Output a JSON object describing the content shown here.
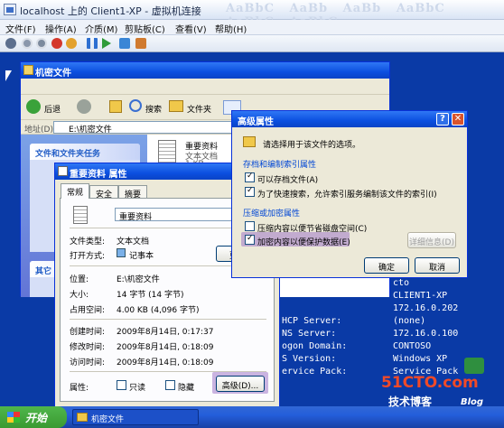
{
  "host": {
    "title": "localhost 上的 Client1-XP - 虚拟机连接",
    "menu": [
      "文件(F)",
      "操作(A)",
      "介质(M)",
      "剪贴板(C)",
      "查看(V)",
      "帮助(H)"
    ]
  },
  "explorer": {
    "title": "机密文件",
    "back": "后退",
    "search": "搜索",
    "folders": "文件夹",
    "address_label": "地址(D)",
    "address_value": "E:\\机密文件",
    "task_panel_title": "文件和文件夹任务",
    "other_panel_title": "其它",
    "file_name": "重要资料",
    "file_type": "文本文档",
    "file_size": "1 KB"
  },
  "console": {
    "lines": [
      "cto",
      "CLIENT1-XP",
      "172.16.0.202",
      "(none)",
      "172.16.0.100",
      "CONTOSO",
      "Windows XP",
      "Service Pack"
    ],
    "labels": [
      "HCP Server:",
      "NS Server:",
      "ogon Domain:",
      "S Version:",
      "ervice Pack:"
    ]
  },
  "props": {
    "title": "重要资料 属性",
    "tabs": [
      "常规",
      "安全",
      "摘要"
    ],
    "name_value": "重要资料",
    "type_label": "文件类型:",
    "type_value": "文本文档",
    "open_label": "打开方式:",
    "open_value": "记事本",
    "change_btn": "更改",
    "loc_label": "位置:",
    "loc_value": "E:\\机密文件",
    "size_label": "大小:",
    "size_value": "14 字节 (14 字节)",
    "disk_label": "占用空间:",
    "disk_value": "4.00 KB (4,096 字节)",
    "created_label": "创建时间:",
    "created_value": "2009年8月14日, 0:17:37",
    "modified_label": "修改时间:",
    "modified_value": "2009年8月14日, 0:18:09",
    "accessed_label": "访问时间:",
    "accessed_value": "2009年8月14日, 0:18:09",
    "attr_label": "属性:",
    "readonly": "只读",
    "hidden": "隐藏",
    "advanced_btn": "高级(D)..."
  },
  "advanced": {
    "title": "高级属性",
    "desc": "请选择用于该文件的选项。",
    "group1": "存档和编制索引属性",
    "opt_archive": "可以存档文件(A)",
    "opt_index": "为了快速搜索，允许索引服务编制该文件的索引(I)",
    "group2": "压缩或加密属性",
    "opt_compress": "压缩内容以便节省磁盘空间(C)",
    "opt_encrypt": "加密内容以便保护数据(E)",
    "details_btn": "详细信息(D)",
    "ok": "确定",
    "cancel": "取消"
  },
  "taskbar": {
    "start": "开始",
    "item": "机密文件"
  },
  "watermark": {
    "logo": "51CTO.com",
    "sub": "技术博客",
    "blog": "Blog"
  },
  "colors": {
    "accent": "#0a3aa6",
    "highlight": "#a078c8"
  }
}
